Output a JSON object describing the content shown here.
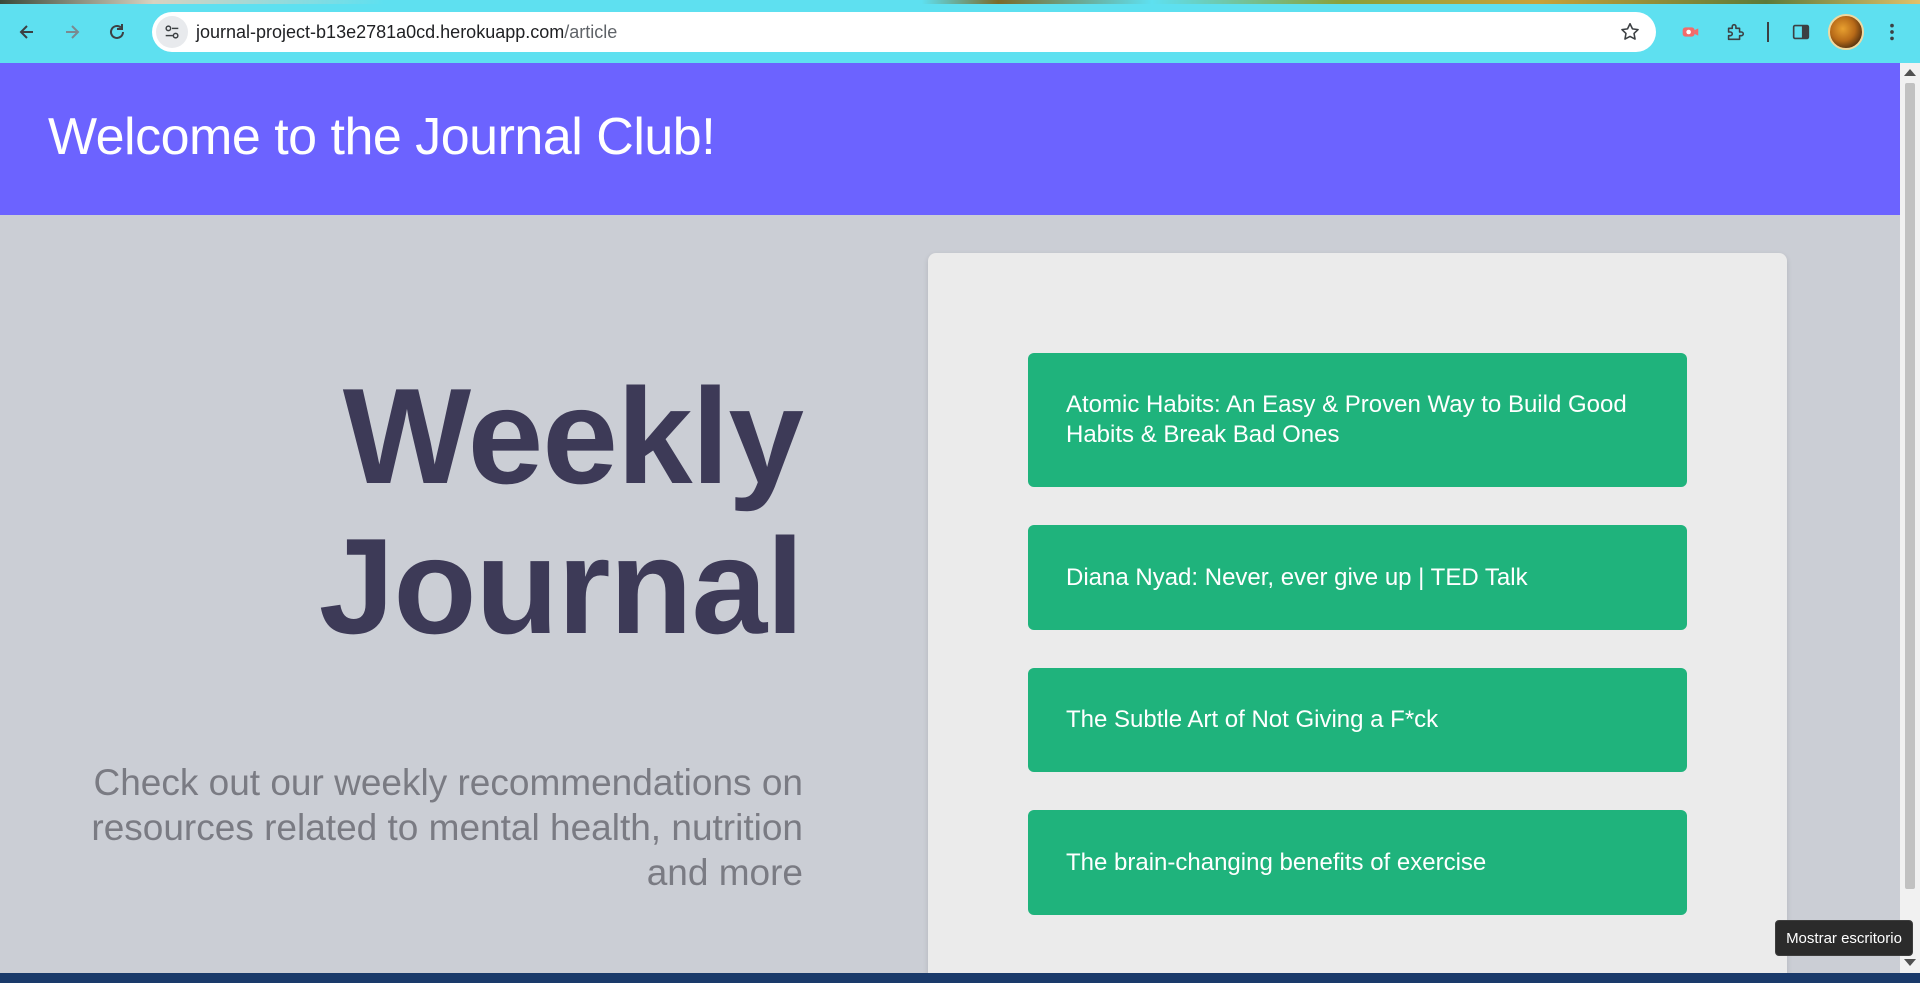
{
  "browser": {
    "url_host": "journal-project-b13e2781a0cd.herokuapp.com",
    "url_path": "/article",
    "colors": {
      "toolbar": "#5ee0f0",
      "omnibox": "#ffffff"
    },
    "icons": [
      "back-arrow-icon",
      "forward-arrow-icon",
      "reload-icon",
      "site-info-icon",
      "bookmark-star-icon",
      "extension-record-icon",
      "extensions-puzzle-icon",
      "side-panel-icon",
      "profile-avatar",
      "more-menu-icon"
    ]
  },
  "header": {
    "title": "Welcome to the Journal Club!",
    "background": "#6c63ff"
  },
  "hero": {
    "title_line1": "Weekly",
    "title_line2": "Journal",
    "subtitle": "Check out our weekly recommendations on resources related to mental health, nutrition and more",
    "title_color": "#3d3a57"
  },
  "articles": [
    {
      "label": "Atomic Habits: An Easy & Proven Way to Build Good Habits & Break Bad Ones"
    },
    {
      "label": "Diana Nyad: Never, ever give up | TED Talk"
    },
    {
      "label": "The Subtle Art of Not Giving a F*ck"
    },
    {
      "label": "The brain-changing benefits of exercise"
    }
  ],
  "article_color": "#1fb37c",
  "tooltip": "Mostrar escritorio"
}
